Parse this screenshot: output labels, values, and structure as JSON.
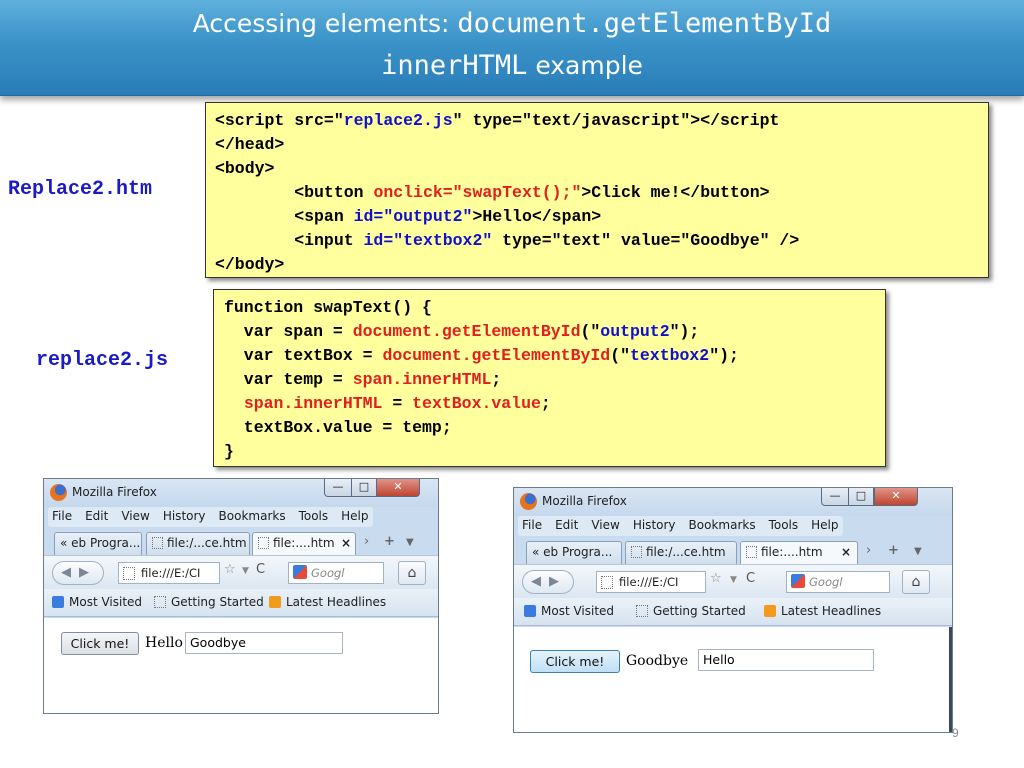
{
  "title": {
    "line1_prefix": "Accessing elements: ",
    "line1_code": "document.getElementById",
    "line2_code": "innerHTML",
    "line2_suffix": " example"
  },
  "labels": {
    "html_file": "Replace2.htm",
    "js_file": "replace2.js"
  },
  "html_code": {
    "l1_a": "<script src=\"",
    "l1_b": "replace2.js",
    "l1_c": "\" type=\"text/javascript\"></script",
    "l2": "</head>",
    "l3": "<body>",
    "l4_a": "        <button ",
    "l4_b": "onclick=\"swapText();\"",
    "l4_c": ">Click me!</button>",
    "l5_a": "        <span ",
    "l5_b": "id=\"output2\"",
    "l5_c": ">Hello</span>",
    "l6_a": "        <input ",
    "l6_b": "id=\"textbox2\"",
    "l6_c": " type=\"text\" value=\"Goodbye\" />",
    "l7": "</body>"
  },
  "js_code": {
    "l1": "function swapText() {",
    "l2_a": "  var span = ",
    "l2_b": "document.getElementById",
    "l2_c": "(\"",
    "l2_d": "output2",
    "l2_e": "\");",
    "l3_a": "  var textBox = ",
    "l3_b": "document.getElementById",
    "l3_c": "(\"",
    "l3_d": "textbox2",
    "l3_e": "\");",
    "l4_a": "  var temp = ",
    "l4_b": "span.innerHTML",
    "l4_c": ";",
    "l5_a": "  ",
    "l5_b": "span.innerHTML",
    "l5_c": " = ",
    "l5_d": "textBox.value",
    "l5_e": ";",
    "l6": "  textBox.value = temp;",
    "l7": "}"
  },
  "browser": {
    "window_title": "Mozilla Firefox",
    "menu": [
      "File",
      "Edit",
      "View",
      "History",
      "Bookmarks",
      "Tools",
      "Help"
    ],
    "tabs": [
      "« eb Progra...",
      "file:/...ce.htm",
      "file:....htm"
    ],
    "url": "file:///E:/CI",
    "search_placeholder": "Googl",
    "bookmarks": [
      "Most Visited",
      "Getting Started",
      "Latest Headlines"
    ],
    "button_label": "Click me!"
  },
  "before": {
    "span_text": "Hello",
    "input_value": "Goodbye"
  },
  "after": {
    "span_text": "Goodbye",
    "input_value": "Hello"
  },
  "slide_number": "9",
  "colors": {
    "banner": "#3a92c8",
    "code_bg": "#ffff9e",
    "highlight_red": "#e02020",
    "highlight_blue": "#1010d0"
  }
}
